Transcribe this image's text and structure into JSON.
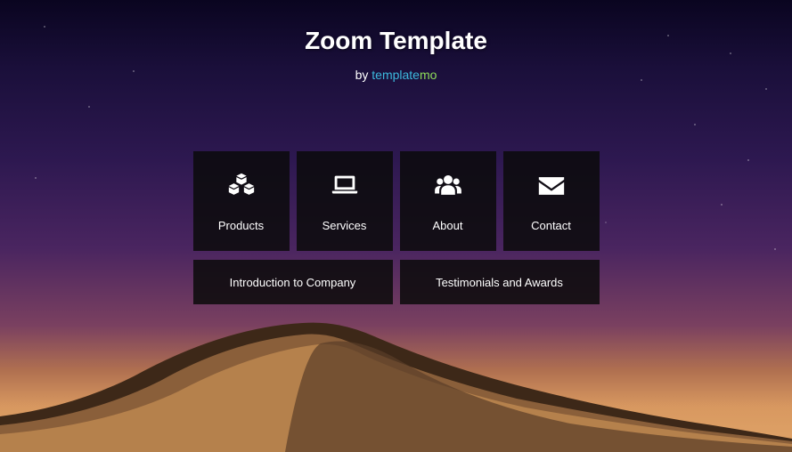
{
  "header": {
    "title": "Zoom Template",
    "subtitle_prefix": "by ",
    "brand_part1": "template",
    "brand_part2": "mo"
  },
  "tiles": [
    {
      "label": "Products",
      "icon": "cubes"
    },
    {
      "label": "Services",
      "icon": "laptop"
    },
    {
      "label": "About",
      "icon": "users"
    },
    {
      "label": "Contact",
      "icon": "envelope"
    }
  ],
  "bars": [
    {
      "label": "Introduction to Company"
    },
    {
      "label": "Testimonials and Awards"
    }
  ]
}
